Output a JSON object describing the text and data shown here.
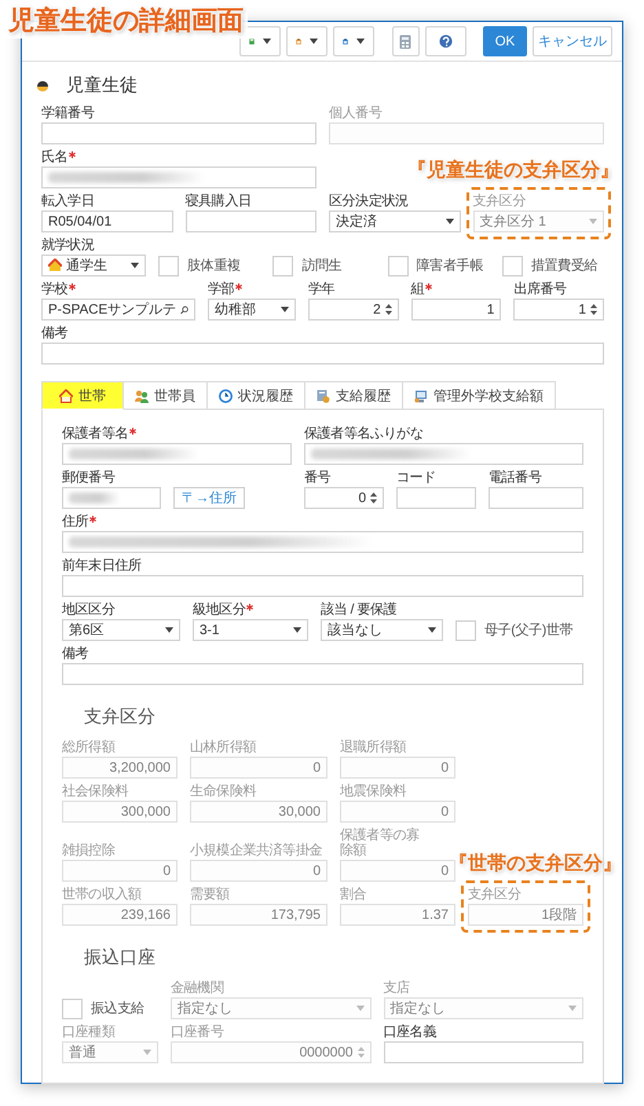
{
  "annotation_title": "児童生徒の詳細画面",
  "toolbar": [
    {
      "kind": "disk-menu"
    },
    {
      "kind": "clipboard-menu"
    },
    {
      "kind": "document-menu"
    },
    {
      "kind": "calculator"
    },
    {
      "kind": "help"
    },
    {
      "kind": "primary",
      "label": "OK"
    },
    {
      "kind": "secondary",
      "label": "キャンセル"
    }
  ],
  "header": {
    "title": "児童生徒"
  },
  "student": {
    "rows": [
      [
        {
          "kind": "text",
          "label": "学籍番号",
          "required": false,
          "disabled": false
        },
        "",
        {
          "kind": "text",
          "label": "個人番号",
          "required": false,
          "disabled": true
        },
        ""
      ],
      [
        {
          "kind": "blurred",
          "label": "氏名",
          "required": true,
          "disabled": false
        },
        ""
      ],
      [
        {
          "kind": "text",
          "label": "転入学日",
          "value": "R05/04/01",
          "required": false,
          "disabled": false
        },
        {
          "kind": "text",
          "label": "寝具購入日",
          "required": false,
          "disabled": false
        },
        {
          "kind": "select",
          "label": "区分決定状況",
          "value": "決定済",
          "required": false,
          "disabled": false
        },
        {
          "kind": "select",
          "label": "支弁区分",
          "value": "支弁区分 1",
          "required": false,
          "disabled": true,
          "callout": "『児童生徒の支弁区分』"
        }
      ],
      [
        {
          "kind": "status-select",
          "label": "就学状況",
          "value": "通学生",
          "required": false,
          "disabled": false
        },
        {
          "kind": "checkbox",
          "text": "肢体重複",
          "checked": false
        },
        {
          "kind": "checkbox",
          "text": "訪問生",
          "checked": false
        },
        {
          "kind": "checkbox",
          "text": "障害者手帳",
          "checked": false
        },
        {
          "kind": "checkbox",
          "text": "措置費受給",
          "checked": false
        }
      ],
      [
        {
          "kind": "search",
          "label": "学校",
          "value": "P-SPACEサンプルテ",
          "required": true,
          "disabled": false
        },
        {
          "kind": "select",
          "label": "学部",
          "value": "幼稚部",
          "required": true,
          "disabled": false
        },
        {
          "kind": "spinner",
          "label": "学年",
          "value": "2",
          "required": false,
          "disabled": false
        },
        {
          "kind": "number",
          "label": "組",
          "value": "1",
          "required": true,
          "disabled": false
        },
        {
          "kind": "spinner",
          "label": "出席番号",
          "value": "1",
          "required": false,
          "disabled": false
        }
      ],
      [
        {
          "kind": "text",
          "label": "備考",
          "required": false,
          "disabled": false
        }
      ]
    ]
  },
  "tabs": [
    {
      "label": "世帯",
      "selected": true,
      "highlighted": true
    },
    {
      "label": "世帯員",
      "selected": false,
      "highlighted": false
    },
    {
      "label": "状況履歴",
      "selected": false,
      "highlighted": false
    },
    {
      "label": "支給履歴",
      "selected": false,
      "highlighted": false
    },
    {
      "label": "管理外学校支給額",
      "selected": false,
      "highlighted": false
    }
  ],
  "household": {
    "rows": [
      [
        {
          "kind": "blurred",
          "label": "保護者等名",
          "required": true,
          "disabled": false
        },
        "",
        {
          "kind": "blurred",
          "label": "保護者等名ふりがな",
          "required": false,
          "disabled": false
        },
        "",
        ""
      ],
      [
        {
          "kind": "blurred",
          "label": "郵便番号",
          "required": false,
          "disabled": false
        },
        {
          "kind": "button",
          "text": "〒→住所"
        },
        {
          "kind": "spinner",
          "label": "番号",
          "value": "0",
          "required": false,
          "disabled": false
        },
        {
          "kind": "text",
          "label": "コード",
          "required": false,
          "disabled": false
        },
        {
          "kind": "text",
          "label": "電話番号",
          "required": false,
          "disabled": false
        }
      ],
      [
        {
          "kind": "blurred",
          "label": "住所",
          "required": true,
          "disabled": false
        }
      ],
      [
        {
          "kind": "text",
          "label": "前年末日住所",
          "required": false,
          "disabled": false
        }
      ],
      [
        {
          "kind": "select",
          "label": "地区区分",
          "value": "第6区",
          "required": false,
          "disabled": false
        },
        {
          "kind": "select",
          "label": "級地区分",
          "value": "3-1",
          "required": true,
          "disabled": false
        },
        {
          "kind": "select",
          "label": "該当 / 要保護",
          "value": "該当なし",
          "required": false,
          "disabled": false
        },
        "",
        {
          "kind": "checkbox",
          "text": "母子(父子)世帯",
          "checked": false
        }
      ],
      [
        {
          "kind": "text",
          "label": "備考",
          "required": false,
          "disabled": false
        }
      ]
    ]
  },
  "support": {
    "heading": "支弁区分",
    "rows": [
      [
        {
          "kind": "number",
          "label": "総所得額",
          "value": "3,200,000",
          "required": false,
          "disabled": true
        },
        {
          "kind": "number",
          "label": "山林所得額",
          "value": "0",
          "required": false,
          "disabled": true
        },
        {
          "kind": "number",
          "label": "退職所得額",
          "value": "0",
          "required": false,
          "disabled": true
        }
      ],
      [
        {
          "kind": "number",
          "label": "社会保険料",
          "value": "300,000",
          "required": false,
          "disabled": true
        },
        {
          "kind": "number",
          "label": "生命保険料",
          "value": "30,000",
          "required": false,
          "disabled": true
        },
        {
          "kind": "number",
          "label": "地震保険料",
          "value": "0",
          "required": false,
          "disabled": true
        }
      ],
      [
        {
          "kind": "number",
          "label": "雑損控除",
          "value": "0",
          "required": false,
          "disabled": true
        },
        {
          "kind": "number",
          "label": "小規模企業共済等掛金",
          "value": "0",
          "required": false,
          "disabled": true
        },
        {
          "kind": "number",
          "label": "保護者等の寡除額",
          "value": "0",
          "required": false,
          "disabled": true
        }
      ],
      [
        {
          "kind": "number",
          "label": "世帯の収入額",
          "value": "239,166",
          "required": false,
          "disabled": true
        },
        {
          "kind": "number",
          "label": "需要額",
          "value": "173,795",
          "required": false,
          "disabled": true
        },
        {
          "kind": "number",
          "label": "割合",
          "value": "1.37",
          "required": false,
          "disabled": true
        },
        {
          "kind": "number",
          "label": "支弁区分",
          "value": "1段階",
          "required": false,
          "disabled": true,
          "callout": "『世帯の支弁区分』"
        }
      ]
    ]
  },
  "bank": {
    "heading": "振込口座",
    "rows": [
      [
        {
          "kind": "checkbox",
          "text": "振込支給",
          "checked": false
        },
        {
          "kind": "select",
          "label": "金融機関",
          "value": "指定なし",
          "required": false,
          "disabled": true
        },
        {
          "kind": "select",
          "label": "支店",
          "value": "指定なし",
          "required": false,
          "disabled": true
        }
      ],
      [
        {
          "kind": "select",
          "label": "口座種類",
          "value": "普通",
          "required": false,
          "disabled": true
        },
        {
          "kind": "spinner",
          "label": "口座番号",
          "value": "0000000",
          "required": false,
          "disabled": true
        },
        {
          "kind": "text",
          "label": "口座名義",
          "required": false,
          "disabled": false
        }
      ]
    ]
  }
}
